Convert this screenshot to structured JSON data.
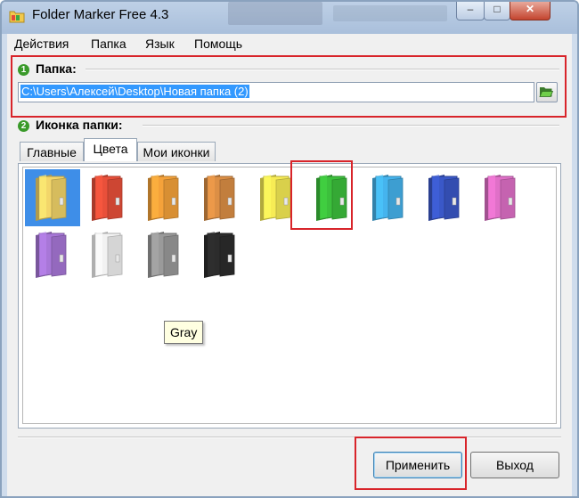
{
  "window": {
    "title": "Folder Marker Free 4.3",
    "controls": {
      "minimize": "–",
      "maximize": "□",
      "close": "✕"
    }
  },
  "menu": [
    "Действия",
    "Папка",
    "Язык",
    "Помощь"
  ],
  "folder_section": {
    "badge": "1",
    "label": "Папка:",
    "path_value": "C:\\Users\\Алексей\\Desktop\\Новая папка (2)",
    "browse_icon": "folder-open-icon"
  },
  "icon_section": {
    "badge": "2",
    "label": "Иконка папки:",
    "tabs": [
      "Главные",
      "Цвета",
      "Мои иконки"
    ],
    "active_tab": "Цвета",
    "folders": [
      {
        "color": "#f3d66a",
        "selected": true
      },
      {
        "color": "#e9503a",
        "selected": false
      },
      {
        "color": "#f5a23a",
        "selected": false
      },
      {
        "color": "#dc8f45",
        "selected": false
      },
      {
        "color": "#f7ec55",
        "selected": false
      },
      {
        "color": "#3cc03c",
        "selected": false
      },
      {
        "color": "#45b4ee",
        "selected": false
      },
      {
        "color": "#3a58c8",
        "selected": false
      },
      {
        "color": "#e070c8",
        "selected": false
      },
      {
        "color": "#a877d8",
        "selected": false
      },
      {
        "color": "#f2f2f2",
        "selected": false
      },
      {
        "color": "#9a9a9a",
        "selected": false
      },
      {
        "color": "#2c2c2c",
        "selected": false
      }
    ],
    "tooltip": "Gray"
  },
  "buttons": {
    "apply": "Применить",
    "exit": "Выход"
  },
  "colors": {
    "highlight_red": "#d8242a",
    "selection_blue": "#3e8ee8"
  }
}
